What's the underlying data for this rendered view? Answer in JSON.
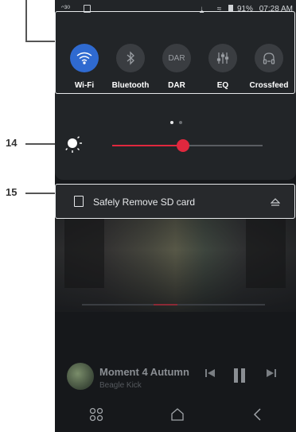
{
  "callouts": {
    "brightness": "14",
    "sd_card": "15"
  },
  "status_bar": {
    "left_text": "ᵔ³⁰",
    "battery": "91%",
    "time": "07:28 AM"
  },
  "quick_tiles": [
    {
      "label": "Wi-Fi",
      "icon": "wifi-icon",
      "active": true
    },
    {
      "label": "Bluetooth",
      "icon": "bluetooth-icon",
      "active": false
    },
    {
      "label": "DAR",
      "icon": "dar-icon",
      "icon_text": "DAR",
      "active": false
    },
    {
      "label": "EQ",
      "icon": "eq-icon",
      "active": false
    },
    {
      "label": "Crossfeed",
      "icon": "headphones-icon",
      "active": false
    }
  ],
  "pager": {
    "pages": 2,
    "current": 1
  },
  "brightness": {
    "level": 0.47
  },
  "notification": {
    "text": "Safely Remove SD card"
  },
  "player": {
    "title": "Moment 4 Autumn",
    "artist": "Beagle Kick"
  },
  "colors": {
    "accent_blue": "#2f6ad0",
    "slider_red": "#e0283e"
  }
}
